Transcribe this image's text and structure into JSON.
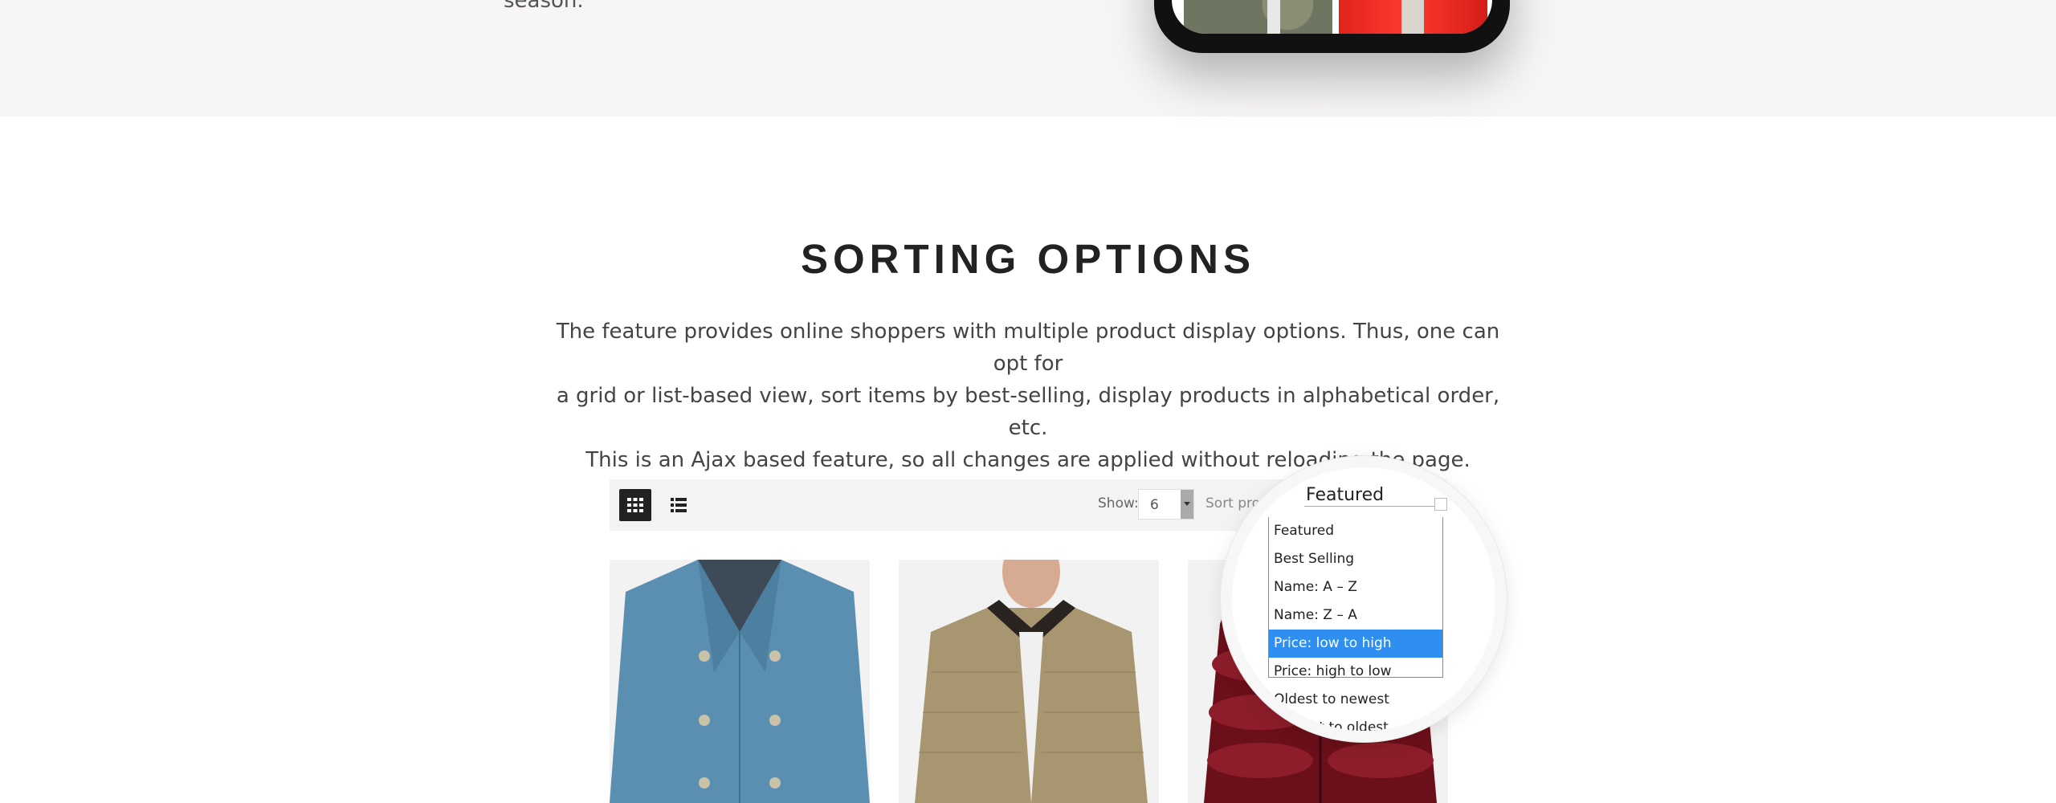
{
  "top": {
    "season_text": "season."
  },
  "section": {
    "title": "SORTING OPTIONS",
    "description": [
      "The feature provides online shoppers with multiple product display options. Thus, one can opt for",
      "a grid or list-based view, sort items by best-selling, display products in alphabetical order, etc.",
      "This is an Ajax based feature, so all changes are applied without reloading the page."
    ]
  },
  "toolbar": {
    "view_grid_icon": "grid-view-icon",
    "view_list_icon": "list-view-icon",
    "show_label": "Show:",
    "show_value": "6",
    "sort_label": "Sort products",
    "sort_selected": "Featured",
    "sort_options": [
      "Featured",
      "Best Selling",
      "Name: A – Z",
      "Name: Z – A",
      "Price: low to high",
      "Price: high to low",
      "Oldest to newest",
      "Newest to oldest"
    ],
    "highlighted_option": "Price: low to high"
  },
  "colors": {
    "accent_highlight": "#2f8ff0",
    "toolbar_bg": "#f3f3f3",
    "top_band_bg": "#f7f6f4"
  },
  "products": [
    {
      "image": "blue-peacoat"
    },
    {
      "image": "khaki-quilted-jacket"
    },
    {
      "image": "burgundy-puffer-jacket"
    }
  ]
}
